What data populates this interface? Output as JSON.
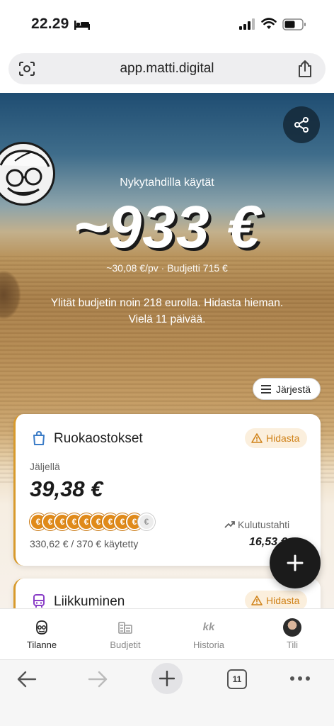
{
  "status_bar": {
    "time": "22.29"
  },
  "browser": {
    "url": "app.matti.digital",
    "tab_count": "11"
  },
  "hero": {
    "pace_caption": "Nykytahdilla käytät",
    "pace_amount": "~933 €",
    "pace_sub": "~30,08 €/pv · Budjetti 715 €",
    "pace_note": "Ylität budjetin noin 218 eurolla. Hidasta hieman. Vielä 11 päivää.",
    "sort_label": "Järjestä"
  },
  "cards": [
    {
      "title": "Ruokaostokset",
      "badge": "Hidasta",
      "remaining_label": "Jäljellä",
      "remaining_value": "39,38 €",
      "coin_symbol": "€",
      "coins_filled": 9,
      "coins_total": 10,
      "spent": "330,62 € / 370 € käytetty",
      "trend_label": "Kulutustahti",
      "trend_value": "16,53 €"
    },
    {
      "title": "Liikkuminen",
      "badge": "Hidasta"
    }
  ],
  "nav": {
    "items": [
      {
        "label": "Tilanne",
        "icon": "face-icon",
        "active": true
      },
      {
        "label": "Budjetit",
        "icon": "stack-icon",
        "active": false
      },
      {
        "label": "Historia",
        "icon": "kk-icon",
        "glyph": "kk",
        "active": false
      },
      {
        "label": "Tili",
        "icon": "avatar",
        "active": false
      }
    ]
  },
  "colors": {
    "accent": "#d89a2c",
    "warning_text": "#d08219",
    "warning_bg": "#fbefdd",
    "coin": "#e08a1a",
    "fab": "#1b1b1b"
  }
}
